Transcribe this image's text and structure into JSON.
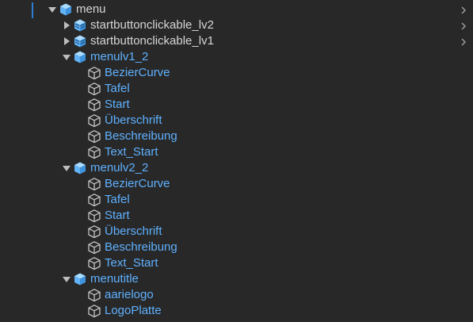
{
  "hierarchy": {
    "items": [
      {
        "label": "menu",
        "depth": 0,
        "expanded": true,
        "icon": "prefab-cube-icon",
        "color": "white",
        "chevron": true
      },
      {
        "label": "startbuttonclickable_lv2",
        "depth": 1,
        "expanded": false,
        "icon": "prefab-variant-icon",
        "color": "white",
        "chevron": true
      },
      {
        "label": "startbuttonclickable_lv1",
        "depth": 1,
        "expanded": false,
        "icon": "prefab-variant-icon",
        "color": "white",
        "chevron": true
      },
      {
        "label": "menulv1_2",
        "depth": 1,
        "expanded": true,
        "icon": "prefab-cube-icon",
        "color": "blue",
        "chevron": false
      },
      {
        "label": "BezierCurve",
        "depth": 2,
        "icon": "gameobject-cube-icon",
        "color": "blue"
      },
      {
        "label": "Tafel",
        "depth": 2,
        "icon": "gameobject-cube-icon",
        "color": "blue"
      },
      {
        "label": "Start",
        "depth": 2,
        "icon": "gameobject-cube-icon",
        "color": "blue"
      },
      {
        "label": "Überschrift",
        "depth": 2,
        "icon": "gameobject-cube-icon",
        "color": "blue"
      },
      {
        "label": "Beschreibung",
        "depth": 2,
        "icon": "gameobject-cube-icon",
        "color": "blue"
      },
      {
        "label": "Text_Start",
        "depth": 2,
        "icon": "gameobject-cube-icon",
        "color": "blue"
      },
      {
        "label": "menulv2_2",
        "depth": 1,
        "expanded": true,
        "icon": "prefab-cube-icon",
        "color": "blue",
        "chevron": false
      },
      {
        "label": "BezierCurve",
        "depth": 2,
        "icon": "gameobject-cube-icon",
        "color": "blue"
      },
      {
        "label": "Tafel",
        "depth": 2,
        "icon": "gameobject-cube-icon",
        "color": "blue"
      },
      {
        "label": "Start",
        "depth": 2,
        "icon": "gameobject-cube-icon",
        "color": "blue"
      },
      {
        "label": "Überschrift",
        "depth": 2,
        "icon": "gameobject-cube-icon",
        "color": "blue"
      },
      {
        "label": "Beschreibung",
        "depth": 2,
        "icon": "gameobject-cube-icon",
        "color": "blue"
      },
      {
        "label": "Text_Start",
        "depth": 2,
        "icon": "gameobject-cube-icon",
        "color": "blue"
      },
      {
        "label": "menutitle",
        "depth": 1,
        "expanded": true,
        "icon": "prefab-cube-icon",
        "color": "blue",
        "chevron": false
      },
      {
        "label": "aarielogo",
        "depth": 2,
        "icon": "gameobject-cube-icon",
        "color": "blue"
      },
      {
        "label": "LogoPlatte",
        "depth": 2,
        "icon": "gameobject-cube-icon",
        "color": "blue"
      }
    ]
  },
  "colors": {
    "background": "#282828",
    "prefab_text": "#5fb1ff",
    "white_text": "#d6d6d6",
    "prefab_icon": "#63b3f7",
    "cube_outline": "#c4c4c4",
    "accent": "#2c7dd3"
  }
}
